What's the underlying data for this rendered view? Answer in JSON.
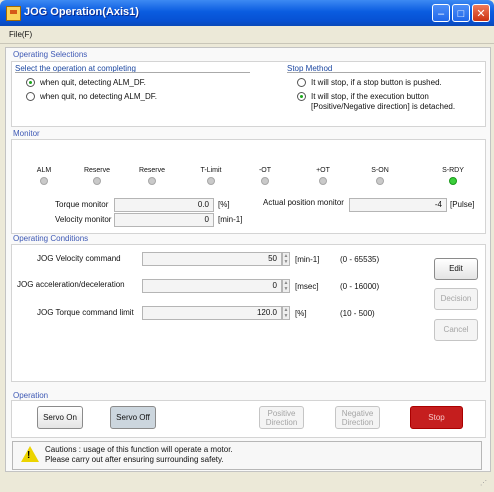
{
  "window": {
    "title": "JOG Operation(Axis1)",
    "minimize": "–",
    "maximize": "□",
    "close": "✕",
    "icon": "app-icon"
  },
  "menu": {
    "file": "File(F)"
  },
  "operating_selections": {
    "title": "Operating Selections",
    "completing": {
      "title": "Select the operation at completing",
      "opt1": "when quit, detecting ALM_DF.",
      "opt2": "when quit, no detecting ALM_DF.",
      "selected": 0
    },
    "stop_method": {
      "title": "Stop Method",
      "opt1": "It will stop, if a stop button is pushed.",
      "opt2_line1": "It will stop, if the execution button",
      "opt2_line2": "[Positive/Negative direction] is detached.",
      "selected": 1
    }
  },
  "monitor": {
    "title": "Monitor",
    "leds": [
      "ALM",
      "Reserve",
      "Reserve",
      "T-Limit",
      "-OT",
      "+OT",
      "S-ON",
      "S-RDY"
    ],
    "led_states": [
      false,
      false,
      false,
      false,
      false,
      false,
      false,
      true
    ],
    "torque_label": "Torque monitor",
    "torque_value": "0.0",
    "torque_unit": "[%]",
    "velocity_label": "Velocity monitor",
    "velocity_value": "0",
    "velocity_unit": "[min-1]",
    "position_label": "Actual position monitor",
    "position_value": "-4",
    "position_unit": "[Pulse]"
  },
  "operating_conditions": {
    "title": "Operating Conditions",
    "velocity_label": "JOG Velocity command",
    "velocity_value": "50",
    "velocity_unit": "[min-1]",
    "velocity_range": "(0 - 65535)",
    "accel_label": "JOG acceleration/deceleration",
    "accel_value": "0",
    "accel_unit": "[msec]",
    "accel_range": "(0 - 16000)",
    "torque_label": "JOG Torque command limit",
    "torque_value": "120.0",
    "torque_unit": "[%]",
    "torque_range": "(10 - 500)",
    "edit": "Edit",
    "decision": "Decision",
    "cancel": "Cancel"
  },
  "operation": {
    "title": "Operation",
    "servo_on": "Servo On",
    "servo_off": "Servo Off",
    "positive_line1": "Positive",
    "positive_line2": "Direction",
    "negative_line1": "Negative",
    "negative_line2": "Direction",
    "stop": "Stop"
  },
  "caution": {
    "line1": "Cautions : usage of this function will operate a motor.",
    "line2": "Please carry out after ensuring surrounding safety.",
    "icon": "warning-icon"
  },
  "colors": {
    "title_bar": "#0a5ce0",
    "section_title": "#3e59b5",
    "led_on": "#3bce3b",
    "stop_button": "#c51e1e"
  }
}
